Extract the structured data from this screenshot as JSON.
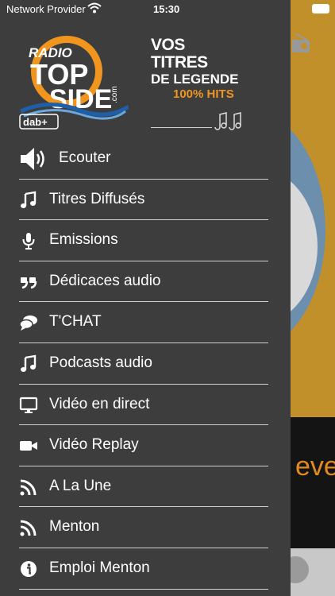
{
  "status_bar": {
    "carrier": "Network Provider",
    "time": "15:30"
  },
  "logo": {
    "radio": "RADIO",
    "top": "TOP",
    "side": "SIDE",
    "com": ".com",
    "dab": "dab+"
  },
  "tagline": {
    "line1": "VOS TITRES",
    "line2": "DE LEGENDE",
    "line3": "100% HITS"
  },
  "menu": [
    {
      "label": "Ecouter",
      "icon": "speaker-icon"
    },
    {
      "label": "Titres Diffusés",
      "icon": "music-note-icon"
    },
    {
      "label": "Emissions",
      "icon": "microphone-icon"
    },
    {
      "label": "Dédicaces audio",
      "icon": "quote-icon"
    },
    {
      "label": "T'CHAT",
      "icon": "chat-icon"
    },
    {
      "label": "Podcasts audio",
      "icon": "music-note-icon"
    },
    {
      "label": "Vidéo en direct",
      "icon": "monitor-icon"
    },
    {
      "label": "Vidéo Replay",
      "icon": "video-camera-icon"
    },
    {
      "label": "A La Une",
      "icon": "rss-icon"
    },
    {
      "label": "Menton",
      "icon": "rss-icon"
    },
    {
      "label": "Emploi Menton",
      "icon": "info-icon"
    }
  ],
  "background_text": "eve",
  "colors": {
    "drawer": "#3d3d3d",
    "accent_orange": "#f0961e",
    "logo_blue": "#1f5fa8"
  }
}
